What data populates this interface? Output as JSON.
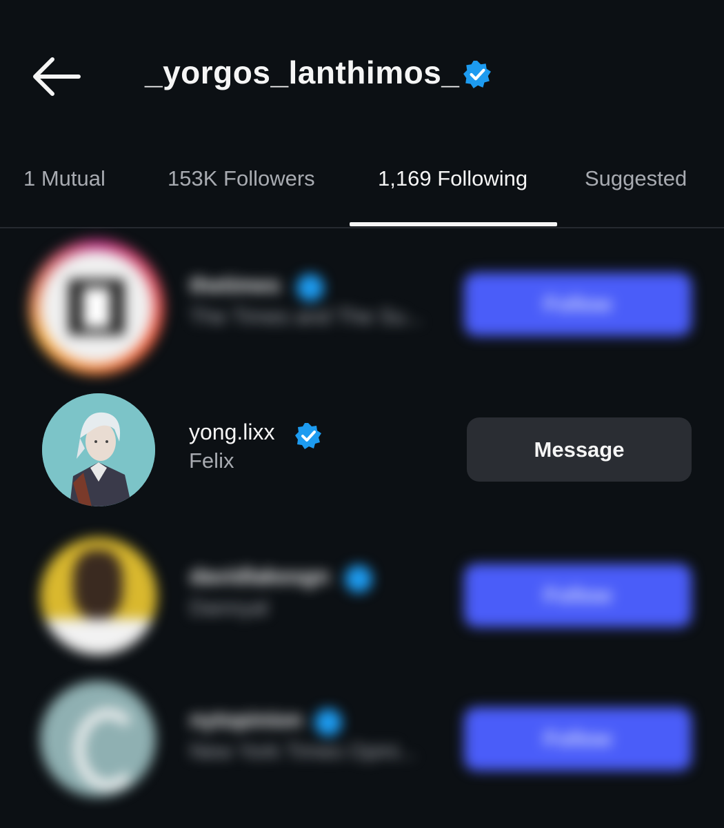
{
  "header": {
    "username": "_yorgos_lanthimos_",
    "back_icon": "arrow-left-icon",
    "verified_icon": "verified-badge-icon"
  },
  "tabs": [
    {
      "label": "1 Mutual",
      "active": false
    },
    {
      "label": "153K Followers",
      "active": false
    },
    {
      "label": "1,169 Following",
      "active": true
    },
    {
      "label": "Suggested",
      "active": false
    }
  ],
  "accounts": [
    {
      "username": "thetimes",
      "fullname": "The Times and The Su...",
      "verified": true,
      "button": "Follow",
      "blurred": true
    },
    {
      "username": "yong.lixx",
      "fullname": "Felix",
      "verified": true,
      "button": "Message",
      "blurred": false
    },
    {
      "username": "davidlakesgn",
      "fullname": "Dannyal",
      "verified": true,
      "button": "Follow",
      "blurred": true
    },
    {
      "username": "nytopinion",
      "fullname": "New York Times Opini...",
      "verified": true,
      "button": "Follow",
      "blurred": true
    }
  ],
  "colors": {
    "background": "#0c1014",
    "verified": "#1d9bf0",
    "follow_button": "#4a5df9",
    "message_button": "#2a2d33"
  }
}
